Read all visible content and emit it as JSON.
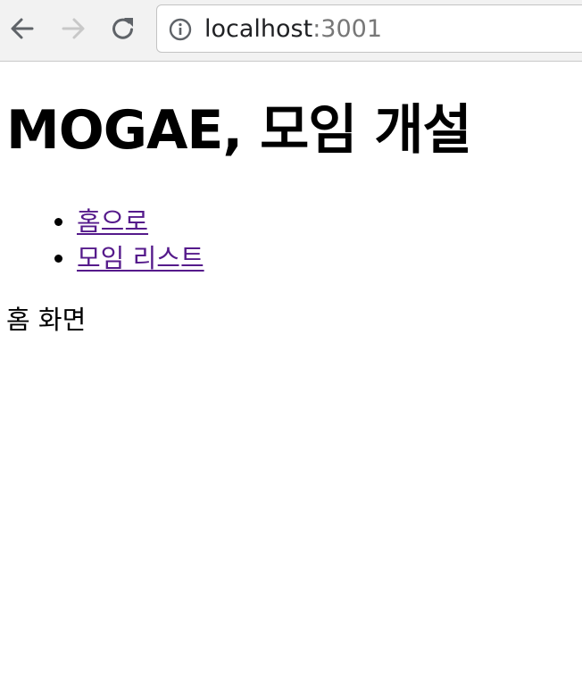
{
  "browser": {
    "url_host": "localhost",
    "url_port": ":3001",
    "icons": {
      "back": "back-arrow-icon",
      "forward": "forward-arrow-icon",
      "reload": "reload-icon",
      "info": "info-icon"
    }
  },
  "page": {
    "title": "MOGAE, 모임 개설",
    "nav_links": [
      {
        "label": "홈으로"
      },
      {
        "label": "모임 리스트"
      }
    ],
    "body_text": "홈 화면",
    "link_color": "#551a8b"
  }
}
